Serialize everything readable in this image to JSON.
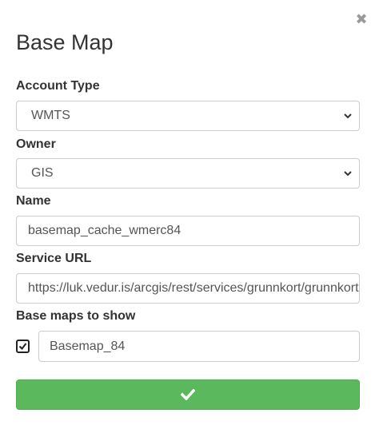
{
  "dialog": {
    "title": "Base Map",
    "close_icon": "close-icon",
    "close_glyph": "✖"
  },
  "form": {
    "account_type": {
      "label": "Account Type",
      "value": "WMTS"
    },
    "owner": {
      "label": "Owner",
      "value": "GIS"
    },
    "name": {
      "label": "Name",
      "value": "basemap_cache_wmerc84"
    },
    "service_url": {
      "label": "Service URL",
      "value": "https://luk.vedur.is/arcgis/rest/services/grunnkort/grunnkort"
    },
    "base_maps": {
      "label": "Base maps to show",
      "items": [
        {
          "checked": true,
          "value": "Basemap_84"
        }
      ]
    }
  },
  "submit": {
    "icon": "checkmark-icon"
  },
  "colors": {
    "submit_bg": "#5cb85c",
    "border": "#cccccc",
    "text": "#333333"
  }
}
